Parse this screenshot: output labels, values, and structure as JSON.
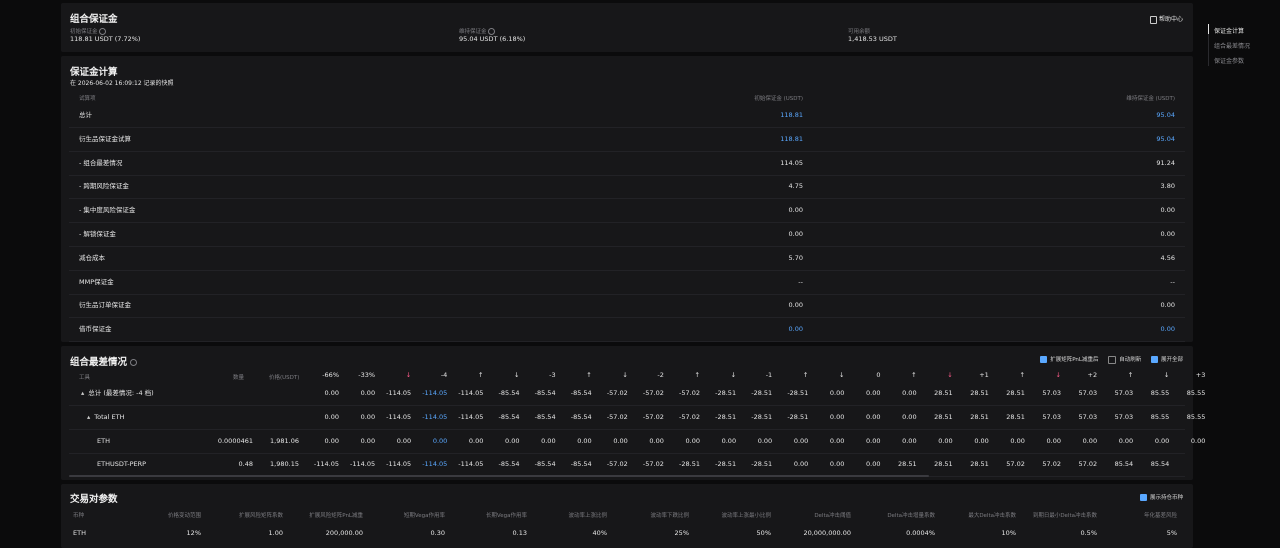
{
  "nav": {
    "items": [
      "保证金计算",
      "组合最差情况",
      "保证金参数"
    ]
  },
  "overview": {
    "title": "组合保证金",
    "help": "帮助中心",
    "initial_label": "初始保证金",
    "initial_value": "118.81 USDT (7.72%)",
    "maint_label": "维持保证金",
    "maint_value": "95.04 USDT (6.18%)",
    "avail_label": "可用余额",
    "avail_value": "1,418.53 USDT"
  },
  "calc": {
    "title": "保证金计算",
    "snapshot": "在 2026-06-02 16:09:12 记录的快照",
    "col_item": "试算项",
    "col_initial": "初始保证金 (USDT)",
    "col_maint": "维持保证金 (USDT)",
    "rows": [
      {
        "name": "总计",
        "initial": "118.81",
        "maint": "95.04",
        "blue": true
      },
      {
        "name": "衍生品保证金试算",
        "initial": "118.81",
        "maint": "95.04",
        "blue": true
      },
      {
        "name": "- 组合最差情况",
        "initial": "114.05",
        "maint": "91.24",
        "blue": false
      },
      {
        "name": "- 跨期风险保证金",
        "initial": "4.75",
        "maint": "3.80",
        "blue": false
      },
      {
        "name": "- 集中度风险保证金",
        "initial": "0.00",
        "maint": "0.00",
        "blue": false
      },
      {
        "name": "- 解锁保证金",
        "initial": "0.00",
        "maint": "0.00",
        "blue": false
      },
      {
        "name": "减仓成本",
        "initial": "5.70",
        "maint": "4.56",
        "blue": false
      },
      {
        "name": "MMP保证金",
        "initial": "--",
        "maint": "--",
        "blue": false
      },
      {
        "name": "衍生品订单保证金",
        "initial": "0.00",
        "maint": "0.00",
        "blue": false
      },
      {
        "name": "借币保证金",
        "initial": "0.00",
        "maint": "0.00",
        "blue": true
      }
    ]
  },
  "worst": {
    "title": "组合最差情况",
    "opt_pnl": "扩展矩阵PnL减重后",
    "opt_refresh": "自动刷新",
    "opt_expand": "展开全部",
    "col_tool": "工具",
    "col_qty": "数量",
    "col_price": "价格(USDT)",
    "headers": [
      "-66%",
      "-33%",
      "↓",
      "-4",
      "↑",
      "↓",
      "-3",
      "↑",
      "↓",
      "-2",
      "↑",
      "↓",
      "-1",
      "↑",
      "↓",
      "0",
      "↑",
      "↓",
      "+1",
      "↑",
      "↓",
      "+2",
      "↑",
      "↓",
      "+3"
    ],
    "rows": [
      {
        "name": "总计 (最差情况: -4 档)",
        "qty": "",
        "price": "",
        "indent": 0,
        "caret": "▴",
        "values": [
          "0.00",
          "0.00",
          "-114.05",
          "-114.05",
          "-114.05",
          "-85.54",
          "-85.54",
          "-85.54",
          "-57.02",
          "-57.02",
          "-57.02",
          "-28.51",
          "-28.51",
          "-28.51",
          "0.00",
          "0.00",
          "0.00",
          "28.51",
          "28.51",
          "28.51",
          "57.03",
          "57.03",
          "57.03",
          "85.55",
          "85.55"
        ]
      },
      {
        "name": "Total ETH",
        "qty": "",
        "price": "",
        "indent": 1,
        "caret": "▴",
        "values": [
          "0.00",
          "0.00",
          "-114.05",
          "-114.05",
          "-114.05",
          "-85.54",
          "-85.54",
          "-85.54",
          "-57.02",
          "-57.02",
          "-57.02",
          "-28.51",
          "-28.51",
          "-28.51",
          "0.00",
          "0.00",
          "0.00",
          "28.51",
          "28.51",
          "28.51",
          "57.03",
          "57.03",
          "57.03",
          "85.55",
          "85.55"
        ]
      },
      {
        "name": "ETH",
        "qty": "0.0000461",
        "price": "1,981.06",
        "indent": 2,
        "caret": "",
        "values": [
          "0.00",
          "0.00",
          "0.00",
          "0.00",
          "0.00",
          "0.00",
          "0.00",
          "0.00",
          "0.00",
          "0.00",
          "0.00",
          "0.00",
          "0.00",
          "0.00",
          "0.00",
          "0.00",
          "0.00",
          "0.00",
          "0.00",
          "0.00",
          "0.00",
          "0.00",
          "0.00",
          "0.00",
          "0.00"
        ]
      },
      {
        "name": "ETHUSDT-PERP",
        "qty": "0.48",
        "price": "1,980.15",
        "indent": 2,
        "caret": "",
        "values": [
          "-114.05",
          "-114.05",
          "-114.05",
          "-114.05",
          "-114.05",
          "-85.54",
          "-85.54",
          "-85.54",
          "-57.02",
          "-57.02",
          "-28.51",
          "-28.51",
          "-28.51",
          "0.00",
          "0.00",
          "0.00",
          "28.51",
          "28.51",
          "28.51",
          "57.02",
          "57.02",
          "57.02",
          "85.54",
          "85.54"
        ]
      }
    ]
  },
  "params": {
    "title": "交易对参数",
    "opt_show": "展示持仓币种",
    "headers": [
      "币种",
      "价格变动范围",
      "扩展风险矩阵系数",
      "扩展风险矩阵PnL减重",
      "短期Vega作用率",
      "长期Vega作用率",
      "波动率上涨比例",
      "波动率下跌比例",
      "波动率上涨最小比例",
      "Delta冲击阈值",
      "Delta冲击增量系数",
      "最大Delta冲击系数",
      "到期日最小Delta冲击系数",
      "年化基差风险"
    ],
    "row": [
      "ETH",
      "12%",
      "1.00",
      "200,000.00",
      "0.30",
      "0.13",
      "40%",
      "25%",
      "50%",
      "20,000,000.00",
      "0.0004%",
      "10%",
      "0.5%",
      "5%"
    ]
  },
  "colors": {
    "accent": "#5aa8ff",
    "down_arrow": "#ff5c8a",
    "panel": "#171719",
    "bg": "#0b0b0c"
  }
}
